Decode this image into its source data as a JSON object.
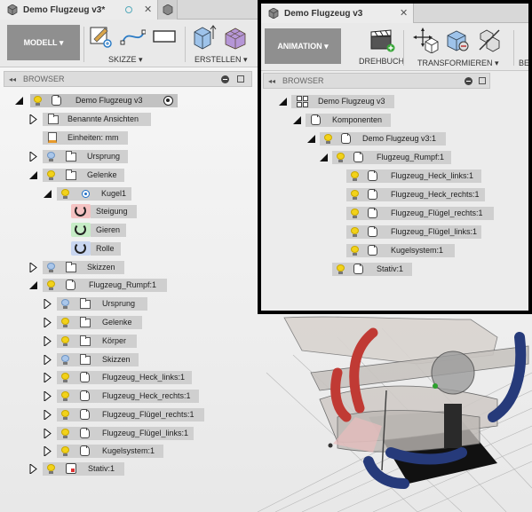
{
  "left": {
    "tab": {
      "title": "Demo Flugzeug v3*"
    },
    "toolbar": {
      "workspace": "MODELL ▾",
      "groups": [
        {
          "label": "SKIZZE ▾"
        },
        {
          "label": "ERSTELLEN ▾"
        }
      ]
    },
    "browser": {
      "title": "BROWSER",
      "rows": [
        "Demo Flugzeug v3",
        "Benannte Ansichten",
        "Einheiten: mm",
        "Ursprung",
        "Gelenke",
        "Kugel1",
        "Steigung",
        "Gieren",
        "Rolle",
        "Skizzen",
        "Flugzeug_Rumpf:1",
        "Ursprung",
        "Gelenke",
        "Körper",
        "Skizzen",
        "Flugzeug_Heck_links:1",
        "Flugzeug_Heck_rechts:1",
        "Flugzeug_Flügel_rechts:1",
        "Flugzeug_Flügel_links:1",
        "Kugelsystem:1",
        "Stativ:1"
      ]
    }
  },
  "right": {
    "tab": {
      "title": "Demo Flugzeug v3"
    },
    "toolbar": {
      "workspace": "ANIMATION ▾",
      "groups": [
        {
          "label": "DREHBUCH"
        },
        {
          "label": "TRANSFORMIEREN ▾"
        },
        {
          "label": "BE"
        }
      ]
    },
    "browser": {
      "title": "BROWSER",
      "rows": [
        "Demo Flugzeug v3",
        "Komponenten",
        "Demo Flugzeug v3:1",
        "Flugzeug_Rumpf:1",
        "Flugzeug_Heck_links:1",
        "Flugzeug_Heck_rechts:1",
        "Flugzeug_Flügel_rechts:1",
        "Flugzeug_Flügel_links:1",
        "Kugelsystem:1",
        "Stativ:1"
      ]
    }
  },
  "colors": {
    "accent_blue": "#1e7ab5",
    "bulb_yellow": "#f2d21a",
    "bulb_blue": "#a9c6ea",
    "joint_red": "#d8383a",
    "joint_green": "#3aa83a",
    "joint_blue": "#2a4fa8"
  }
}
